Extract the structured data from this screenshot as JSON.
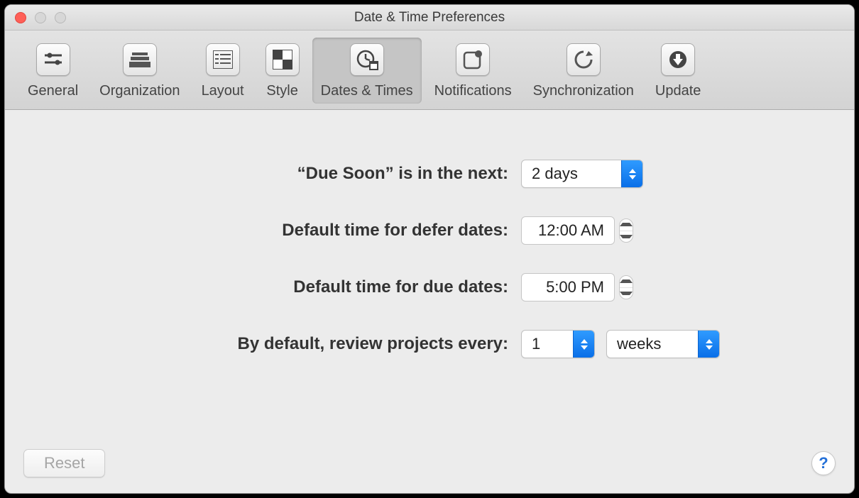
{
  "window": {
    "title": "Date & Time Preferences"
  },
  "toolbar": {
    "items": [
      {
        "label": "General"
      },
      {
        "label": "Organization"
      },
      {
        "label": "Layout"
      },
      {
        "label": "Style"
      },
      {
        "label": "Dates & Times"
      },
      {
        "label": "Notifications"
      },
      {
        "label": "Synchronization"
      },
      {
        "label": "Update"
      }
    ],
    "active_index": 4
  },
  "form": {
    "due_soon": {
      "label": "“Due Soon” is in the next:",
      "value": "2 days"
    },
    "defer_time": {
      "label": "Default time for defer dates:",
      "value": "12:00 AM"
    },
    "due_time": {
      "label": "Default time for due dates:",
      "value": "5:00 PM"
    },
    "review": {
      "label": "By default, review projects every:",
      "count": "1",
      "unit": "weeks"
    }
  },
  "footer": {
    "reset": "Reset",
    "help": "?"
  }
}
